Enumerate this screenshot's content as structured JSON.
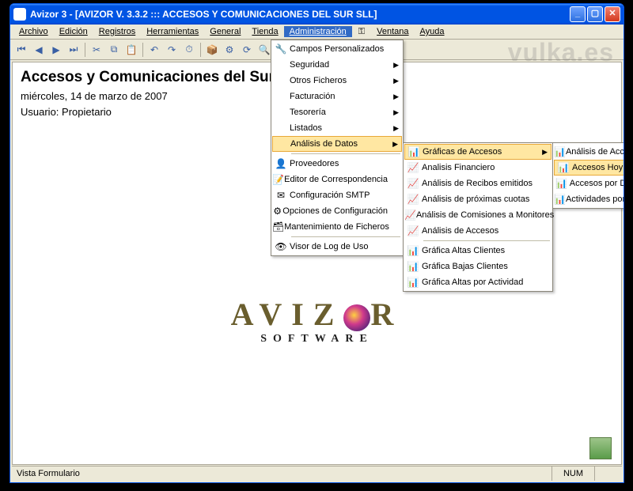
{
  "title": "Avizor 3 - [AVIZOR V. 3.3.2 ::: ACCESOS Y COMUNICACIONES DEL SUR SLL]",
  "menubar": {
    "items": [
      "Archivo",
      "Edición",
      "Registros",
      "Herramientas",
      "General",
      "Tienda",
      "Administración",
      "Ventana",
      "Ayuda"
    ],
    "active_index": 6
  },
  "content": {
    "heading": "Accesos y Comunicaciones del Sur SLL",
    "date": "miércoles, 14 de marzo de 2007",
    "user_label": "Usuario:",
    "user_value": "Propietario"
  },
  "logo": {
    "top": "AVIZ",
    "top2": "R",
    "sub": "SOFTWARE"
  },
  "status": {
    "left": "Vista Formulario",
    "num": "NUM"
  },
  "menu_admin": [
    {
      "label": "Campos Personalizados",
      "icon": "🔧"
    },
    {
      "label": "Seguridad",
      "sub": true
    },
    {
      "label": "Otros Ficheros",
      "sub": true
    },
    {
      "label": "Facturación",
      "sub": true
    },
    {
      "label": "Tesorería",
      "sub": true
    },
    {
      "label": "Listados",
      "sub": true
    },
    {
      "label": "Análisis de Datos",
      "sub": true,
      "hl": true
    },
    {
      "label": "Proveedores",
      "icon": "👤",
      "sep_before": true
    },
    {
      "label": "Editor de Correspondencia",
      "icon": "📝"
    },
    {
      "label": "Configuración SMTP",
      "icon": "✉"
    },
    {
      "label": "Opciones de Configuración",
      "icon": "⚙"
    },
    {
      "label": "Mantenimiento de Ficheros",
      "icon": "🗃"
    },
    {
      "label": "Visor de Log de Uso",
      "icon": "👁",
      "sep_before": true
    }
  ],
  "menu_analisis": [
    {
      "label": "Gráficas de Accesos",
      "icon": "📊",
      "sub": true,
      "hl": true
    },
    {
      "label": "Analisis Financiero",
      "icon": "📈"
    },
    {
      "label": "Análisis de Recibos emitidos",
      "icon": "📈"
    },
    {
      "label": "Análisis de próximas cuotas",
      "icon": "📈"
    },
    {
      "label": "Análisis de Comisiones a Monitores",
      "icon": "📈"
    },
    {
      "label": "Análisis de Accesos",
      "icon": "📈"
    },
    {
      "label": "Gráfica Altas Clientes",
      "icon": "📊",
      "sep_before": true
    },
    {
      "label": "Gráfica Bajas Clientes",
      "icon": "📊"
    },
    {
      "label": "Gráfica Altas por Actividad",
      "icon": "📊"
    }
  ],
  "menu_graficas": [
    {
      "label": "Análisis de Accesos",
      "icon": "📊"
    },
    {
      "label": "Accesos Hoy",
      "icon": "📊",
      "hl": true
    },
    {
      "label": "Accesos por Días",
      "icon": "📊"
    },
    {
      "label": "Actividades por Meses",
      "icon": "📊"
    }
  ],
  "watermark": "vulka.es"
}
